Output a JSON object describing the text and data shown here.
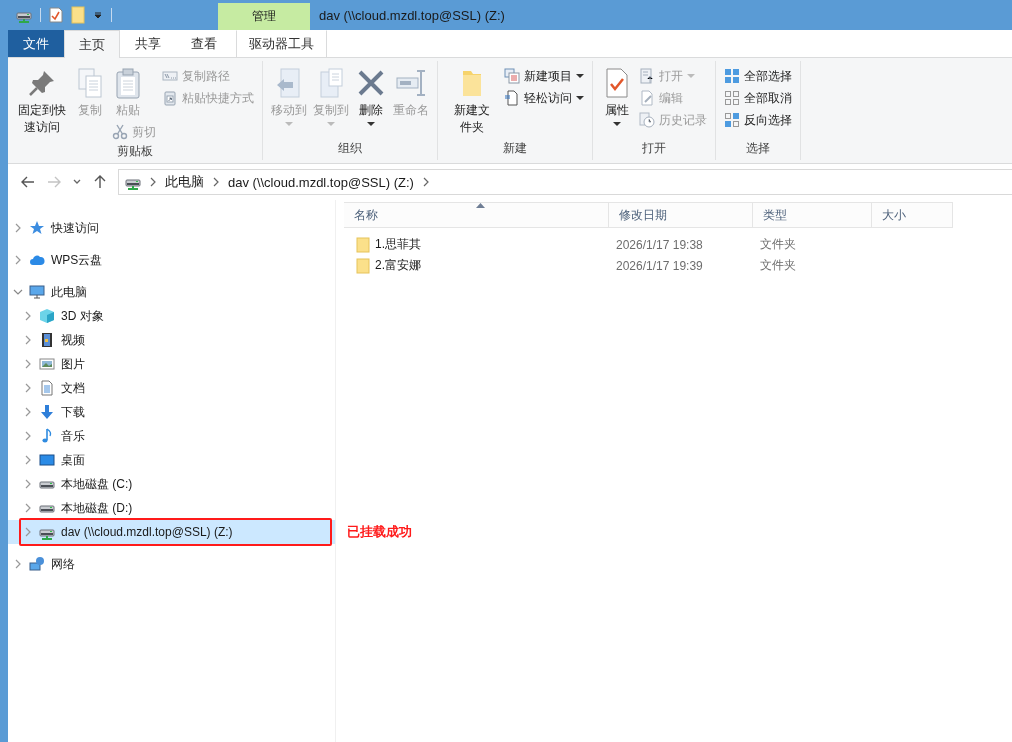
{
  "title_bar": {
    "context_tab": "管理",
    "title": "dav (\\\\cloud.mzdl.top@SSL) (Z:)"
  },
  "ribbon_tabs": [
    {
      "label": "文件",
      "kind": "file",
      "selected": false
    },
    {
      "label": "主页",
      "kind": "tab",
      "selected": true
    },
    {
      "label": "共享",
      "kind": "tab",
      "selected": false
    },
    {
      "label": "查看",
      "kind": "tab",
      "selected": false
    },
    {
      "label": "驱动器工具",
      "kind": "context",
      "selected": false
    }
  ],
  "ribbon_groups": [
    {
      "label": "剪贴板",
      "columns": [
        [
          {
            "label": "固定到快速访问",
            "kind": "large",
            "disabled": false,
            "dropdown": false
          }
        ],
        [
          {
            "label": "复制",
            "kind": "large",
            "disabled": true,
            "dropdown": false
          }
        ],
        [
          {
            "label": "粘贴",
            "kind": "large",
            "disabled": true,
            "dropdown": false
          },
          {
            "label": "剪切",
            "kind": "small",
            "disabled": true,
            "dropdown": false
          }
        ],
        [
          {
            "label": "复制路径",
            "kind": "small",
            "disabled": true,
            "dropdown": false
          },
          {
            "label": "粘贴快捷方式",
            "kind": "small",
            "disabled": true,
            "dropdown": false
          }
        ]
      ]
    },
    {
      "label": "组织",
      "columns": [
        [
          {
            "label": "移动到",
            "kind": "large",
            "disabled": true,
            "dropdown": true
          }
        ],
        [
          {
            "label": "复制到",
            "kind": "large",
            "disabled": true,
            "dropdown": true
          }
        ],
        [
          {
            "label": "删除",
            "kind": "large",
            "disabled": false,
            "dropdown": true
          }
        ],
        [
          {
            "label": "重命名",
            "kind": "large",
            "disabled": true,
            "dropdown": false
          }
        ]
      ]
    },
    {
      "label": "新建",
      "columns": [
        [
          {
            "label": "新建文件夹",
            "kind": "large",
            "disabled": false,
            "dropdown": false
          }
        ],
        [
          {
            "label": "新建项目",
            "kind": "small",
            "disabled": false,
            "dropdown": true
          },
          {
            "label": "轻松访问",
            "kind": "small",
            "disabled": false,
            "dropdown": true
          }
        ]
      ]
    },
    {
      "label": "打开",
      "columns": [
        [
          {
            "label": "属性",
            "kind": "large",
            "disabled": false,
            "dropdown": true
          }
        ],
        [
          {
            "label": "打开",
            "kind": "small",
            "disabled": true,
            "dropdown": true
          },
          {
            "label": "编辑",
            "kind": "small",
            "disabled": true,
            "dropdown": false
          },
          {
            "label": "历史记录",
            "kind": "small",
            "disabled": true,
            "dropdown": false
          }
        ]
      ]
    },
    {
      "label": "选择",
      "columns": [
        [
          {
            "label": "全部选择",
            "kind": "small",
            "disabled": false,
            "dropdown": false
          },
          {
            "label": "全部取消",
            "kind": "small",
            "disabled": false,
            "dropdown": false
          },
          {
            "label": "反向选择",
            "kind": "small",
            "disabled": false,
            "dropdown": false
          }
        ]
      ]
    }
  ],
  "address": {
    "crumbs": [
      "此电脑",
      "dav (\\\\cloud.mzdl.top@SSL) (Z:)"
    ]
  },
  "tree": [
    {
      "label": "快速访问",
      "selected": false,
      "expanded": false
    },
    {
      "label": "WPS云盘",
      "selected": false,
      "expanded": false
    },
    {
      "label": "此电脑",
      "selected": false,
      "expanded": true,
      "children": [
        {
          "label": "3D 对象",
          "selected": false,
          "expanded": false
        },
        {
          "label": "视频",
          "selected": false,
          "expanded": false
        },
        {
          "label": "图片",
          "selected": false,
          "expanded": false
        },
        {
          "label": "文档",
          "selected": false,
          "expanded": false
        },
        {
          "label": "下载",
          "selected": false,
          "expanded": false
        },
        {
          "label": "音乐",
          "selected": false,
          "expanded": false
        },
        {
          "label": "桌面",
          "selected": false,
          "expanded": false
        },
        {
          "label": "本地磁盘 (C:)",
          "selected": false,
          "expanded": false
        },
        {
          "label": "本地磁盘 (D:)",
          "selected": false,
          "expanded": false
        },
        {
          "label": "dav (\\\\cloud.mzdl.top@SSL) (Z:)",
          "selected": true,
          "expanded": false,
          "callout": "已挂载成功"
        }
      ]
    },
    {
      "label": "网络",
      "selected": false,
      "expanded": false
    }
  ],
  "columns": [
    {
      "label": "名称",
      "sorted": true
    },
    {
      "label": "修改日期",
      "sorted": false
    },
    {
      "label": "类型",
      "sorted": false
    },
    {
      "label": "大小",
      "sorted": false
    }
  ],
  "files": [
    {
      "name": "1.思菲其",
      "modified": "2026/1/17 19:38",
      "type": "文件夹"
    },
    {
      "name": "2.富安娜",
      "modified": "2026/1/17 19:39",
      "type": "文件夹"
    }
  ]
}
